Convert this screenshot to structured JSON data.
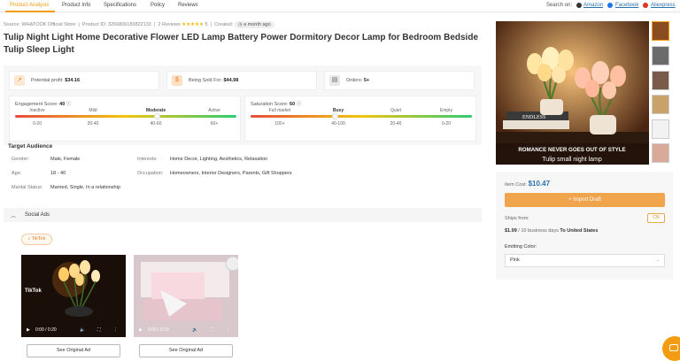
{
  "tabs": [
    "Product Analysis",
    "Product Info",
    "Specifications",
    "Policy",
    "Reviews"
  ],
  "search_on": {
    "label": "Search on:",
    "sources": [
      "Amazon",
      "Facebook",
      "Aliexpress"
    ]
  },
  "meta": {
    "source": "Source: WHATOOK Official Store",
    "product_id": "Product ID: 3256806183822133",
    "reviews": "2 Reviews",
    "stars": "★★★★★",
    "rating": "5",
    "created_label": "Created:",
    "created_value": "a month ago"
  },
  "title": "Tulip Night Light Home Decorative Flower LED Lamp Battery Power Dormitory Decor Lamp for Bedroom Bedside Tulip Sleep Light",
  "stats": {
    "potential_profit_label": "Potential profit:",
    "potential_profit_value": "$34.16",
    "being_sold_label": "Being Sold For:",
    "being_sold_value": "$44.98",
    "orders_label": "Orders:",
    "orders_value": "5+"
  },
  "engagement": {
    "title": "Engagement Score:",
    "score": "40",
    "info_icon": "info-icon",
    "labels": [
      "Inactive",
      "Mild",
      "Moderate",
      "Active"
    ],
    "ranges": [
      "0-20",
      "20-40",
      "40-60",
      "60+"
    ],
    "active_index": 2,
    "level": 0.64
  },
  "saturation": {
    "title": "Saturation Score:",
    "score": "60",
    "info_icon": "info-icon",
    "labels": [
      "Full market",
      "Busy",
      "Quiet",
      "Empty"
    ],
    "ranges": [
      "100+",
      "40-100",
      "20-40",
      "0-20"
    ],
    "active_index": 1,
    "level": 0.38
  },
  "target_audience": {
    "heading": "Target Audience",
    "gender_key": "Gender:",
    "gender_val": "Male, Female",
    "age_key": "Age:",
    "age_val": "18 - 40",
    "marital_key": "Marital Status:",
    "marital_val": "Married, Single, In a relationship",
    "interests_key": "Interests:",
    "interests_val": "Home Decor, Lighting, Aesthetics, Relaxation",
    "occupation_key": "Occupation:",
    "occupation_val": "Homeowners, Interior Designers, Parents, Gift Shoppers"
  },
  "social_ads": {
    "label": "Social Ads",
    "platform_chip": "TikTok",
    "videos": [
      {
        "time": "0:00 / 0:20",
        "watermark": "TikTok",
        "button": "See Original Ad"
      },
      {
        "time": "0:00 / 0:19",
        "button": "See Original Ad"
      }
    ]
  },
  "hero": {
    "caption1": "ROMANCE NEVER GOES OUT OF STYLE",
    "caption2": "Tulip small night lamp",
    "book_text": "ENDLESS"
  },
  "buy": {
    "item_cost_label": "Item Cost:",
    "item_cost_value": "$10.47",
    "import_label": "Import Draft",
    "import_icon": "plus-icon",
    "ships_from_label": "Ships from:",
    "ships_from_value": "CN",
    "ship_price": "$1.99",
    "ship_days": "/ 10 business days",
    "ship_dest": "To United States",
    "emitting_label": "Emitting Color:",
    "emitting_value": "Pink"
  },
  "colors": {
    "accent": "#f39c12",
    "link": "#2a6fb0"
  }
}
